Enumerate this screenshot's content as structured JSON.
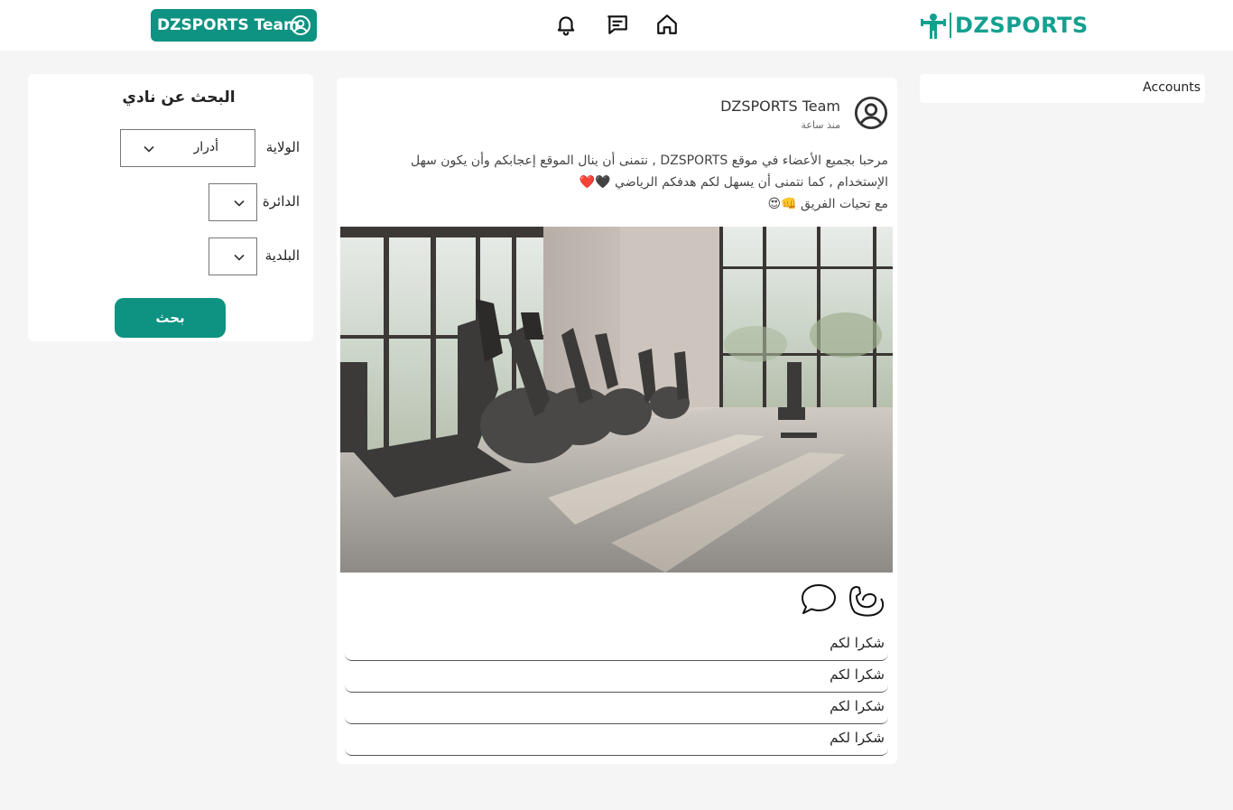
{
  "header": {
    "profile_name": "DZSPORTS Team",
    "logo_text": "DZSPORTS",
    "nav_icons": [
      "bell-icon",
      "message-icon",
      "home-icon"
    ],
    "brand_color": "#0e9281"
  },
  "search": {
    "title": "البحث عن نادي",
    "state_label": "الولاية",
    "state_value": "أدرار",
    "district_label": "الدائرة",
    "district_value": "",
    "commune_label": "البلدية",
    "commune_value": "",
    "button_label": "بحث"
  },
  "post": {
    "author": "DZSPORTS Team",
    "time": "منذ ساعة",
    "line1": "مرحبا بجميع الأعضاء في موقع DZSPORTS , نتمنى أن ينال الموقع إعجابكم وأن يكون سهل",
    "line2": "الإستخدام , كما نتمنى أن يسهل لكم هدفكم الرياضي 🖤❤️",
    "line3": "مع تحيات الفريق 👊😍",
    "image_alt": "gym-interior-photo",
    "actions": [
      "flex-biceps-icon",
      "comment-icon"
    ],
    "comments": [
      {
        "text": "شكرا لكم"
      },
      {
        "text": "شكرا لكم"
      },
      {
        "text": "شكرا لكم"
      },
      {
        "text": "شكرا لكم"
      }
    ]
  },
  "sidebar_right": {
    "title": "Accounts"
  }
}
